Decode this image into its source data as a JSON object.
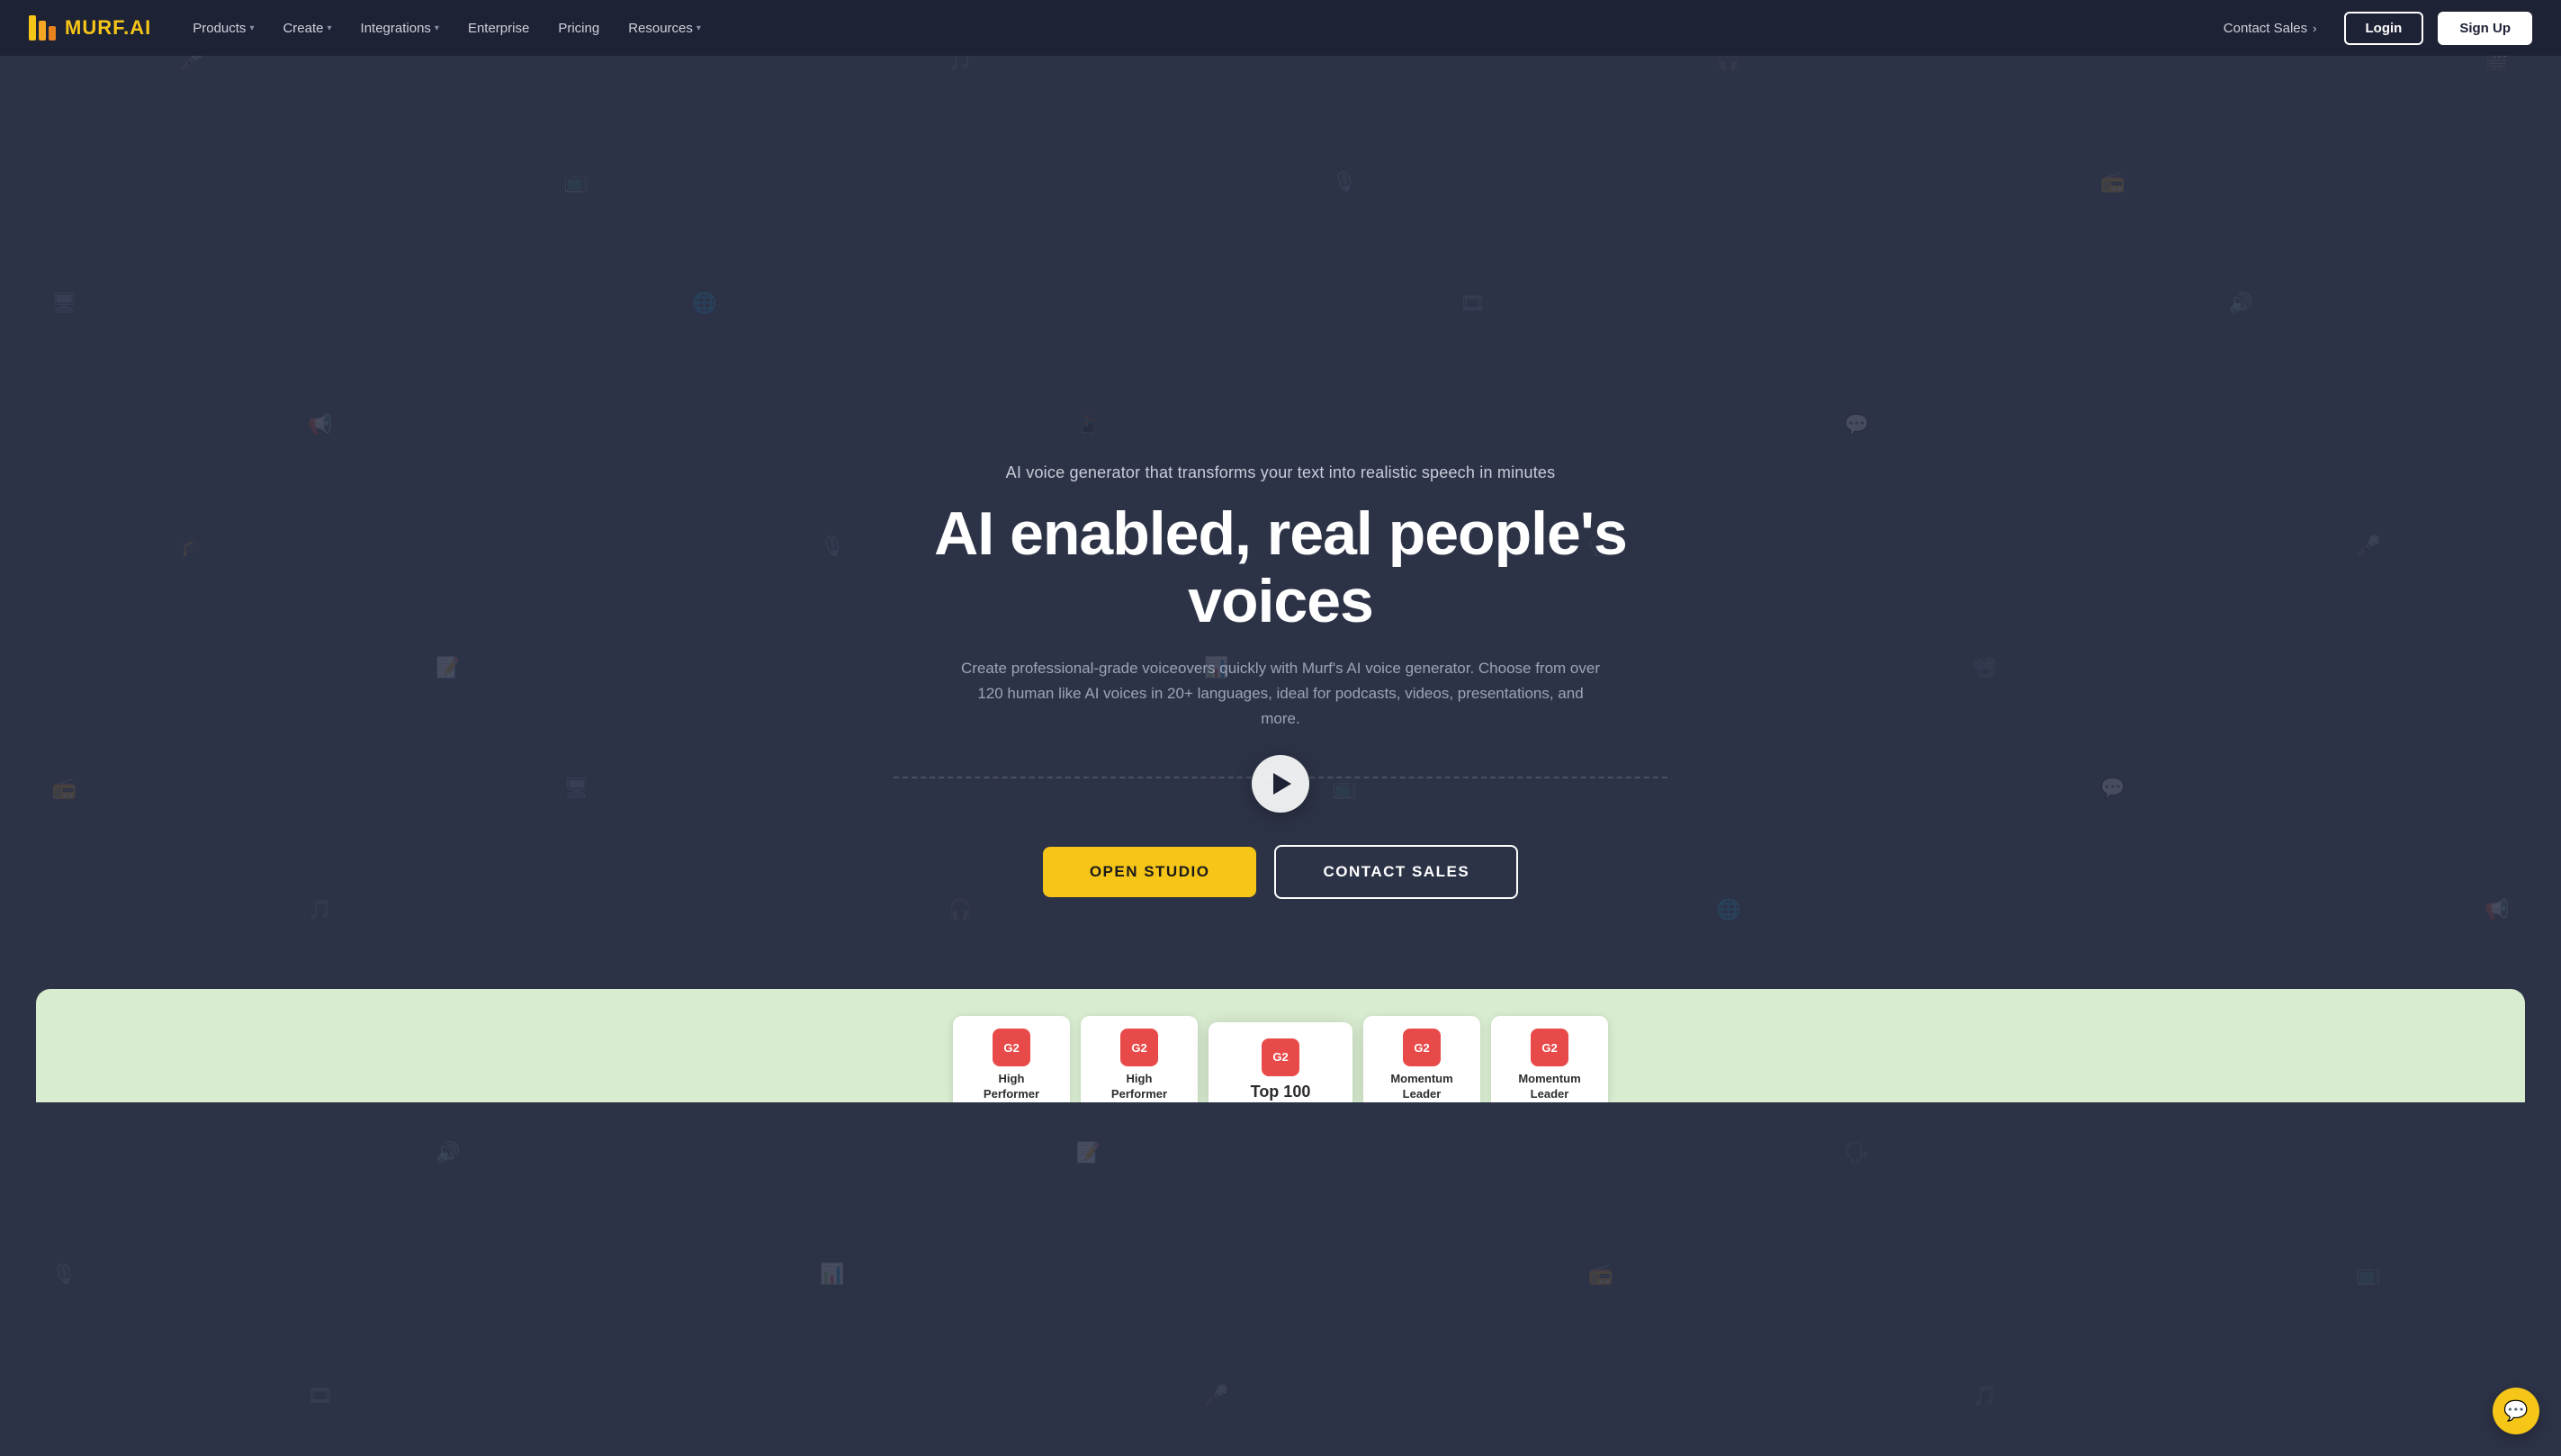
{
  "brand": {
    "name": "MURF.AI",
    "logo_text": "MURF",
    "logo_suffix": ".AI"
  },
  "nav": {
    "items": [
      {
        "label": "Products",
        "has_dropdown": true
      },
      {
        "label": "Create",
        "has_dropdown": true
      },
      {
        "label": "Integrations",
        "has_dropdown": true
      },
      {
        "label": "Enterprise",
        "has_dropdown": false
      },
      {
        "label": "Pricing",
        "has_dropdown": false
      },
      {
        "label": "Resources",
        "has_dropdown": true
      }
    ],
    "contact_sales": "Contact Sales",
    "login": "Login",
    "signup": "Sign Up"
  },
  "hero": {
    "subtitle": "AI voice generator that transforms your text into realistic speech in minutes",
    "title": "AI enabled, real people's voices",
    "description": "Create professional-grade voiceovers quickly with Murf's AI voice generator. Choose from over 120 human like AI voices in 20+ languages, ideal for podcasts, videos, presentations, and more.",
    "cta_primary": "OPEN STUDIO",
    "cta_secondary": "CONTACT SALES"
  },
  "awards": [
    {
      "badge": "G2",
      "label": "High\nPerformer",
      "featured": false
    },
    {
      "badge": "G2",
      "label": "High\nPerformer",
      "featured": false
    },
    {
      "badge": "G2",
      "label": "Top 100",
      "featured": true
    },
    {
      "badge": "G2",
      "label": "Momentum\nLeader",
      "featured": false
    },
    {
      "badge": "G2",
      "label": "Momentum\nLeader",
      "featured": false
    }
  ],
  "chat": {
    "icon": "💬"
  }
}
